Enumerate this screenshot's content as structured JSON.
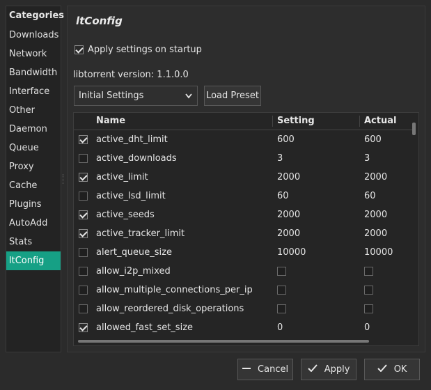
{
  "sidebar": {
    "header": "Categories",
    "items": [
      {
        "label": "Downloads"
      },
      {
        "label": "Network"
      },
      {
        "label": "Bandwidth"
      },
      {
        "label": "Interface"
      },
      {
        "label": "Other"
      },
      {
        "label": "Daemon"
      },
      {
        "label": "Queue"
      },
      {
        "label": "Proxy"
      },
      {
        "label": "Cache"
      },
      {
        "label": "Plugins"
      },
      {
        "label": "AutoAdd"
      },
      {
        "label": "Stats"
      },
      {
        "label": "ltConfig",
        "active": true
      }
    ]
  },
  "panel": {
    "title": "ltConfig",
    "apply_on_startup_label": "Apply settings on startup",
    "apply_on_startup": true,
    "version_text": "libtorrent version: 1.1.0.0",
    "preset_combo_value": "Initial Settings",
    "load_preset_label": "Load Preset"
  },
  "table": {
    "headers": {
      "name": "Name",
      "setting": "Setting",
      "actual": "Actual"
    },
    "rows": [
      {
        "checked": true,
        "name": "active_dht_limit",
        "setting": "600",
        "actual": "600"
      },
      {
        "checked": false,
        "name": "active_downloads",
        "setting": "3",
        "actual": "3"
      },
      {
        "checked": true,
        "name": "active_limit",
        "setting": "2000",
        "actual": "2000"
      },
      {
        "checked": false,
        "name": "active_lsd_limit",
        "setting": "60",
        "actual": "60"
      },
      {
        "checked": true,
        "name": "active_seeds",
        "setting": "2000",
        "actual": "2000"
      },
      {
        "checked": true,
        "name": "active_tracker_limit",
        "setting": "2000",
        "actual": "2000"
      },
      {
        "checked": false,
        "name": "alert_queue_size",
        "setting": "10000",
        "actual": "10000"
      },
      {
        "checked": false,
        "name": "allow_i2p_mixed",
        "setting": "",
        "actual": "",
        "bool": true
      },
      {
        "checked": false,
        "name": "allow_multiple_connections_per_ip",
        "setting": "",
        "actual": "",
        "bool": true
      },
      {
        "checked": false,
        "name": "allow_reordered_disk_operations",
        "setting": "",
        "actual": "",
        "bool": true
      },
      {
        "checked": true,
        "name": "allowed_fast_set_size",
        "setting": "0",
        "actual": "0"
      }
    ]
  },
  "footer": {
    "cancel_label": "Cancel",
    "apply_label": "Apply",
    "ok_label": "OK"
  },
  "colors": {
    "accent": "#16a085",
    "background": "#2b2b2b"
  }
}
